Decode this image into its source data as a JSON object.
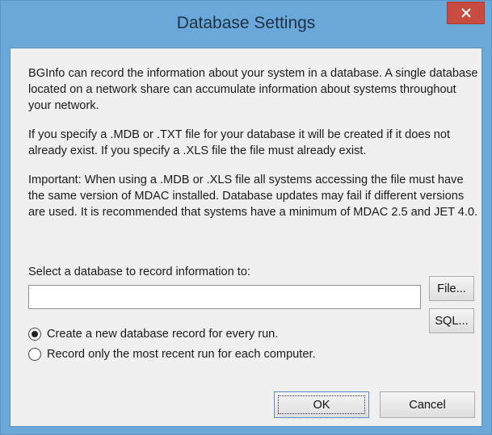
{
  "window": {
    "title": "Database Settings"
  },
  "description": {
    "p1": "BGInfo can record the information about your system in a database. A single database located on a network share can accumulate information about systems throughout your network.",
    "p2": "If you specify a .MDB or .TXT file for your database it will be created if it does not already exist. If you specify a .XLS file the file must already exist.",
    "p3": "Important: When using a .MDB or .XLS file all systems accessing the file must have the same version of MDAC installed. Database updates may fail if different versions are used. It is recommended that systems have a minimum of MDAC 2.5 and JET 4.0."
  },
  "database": {
    "label": "Select a database to record information to:",
    "value": "",
    "file_button": "File...",
    "sql_button": "SQL..."
  },
  "options": [
    {
      "label": "Create a new database record for every run.",
      "selected": true
    },
    {
      "label": "Record only the most recent run for each computer.",
      "selected": false
    }
  ],
  "buttons": {
    "ok": "OK",
    "cancel": "Cancel"
  },
  "colors": {
    "frame": "#6aa8d9",
    "close": "#c74b3f",
    "client": "#f0f0f0"
  }
}
